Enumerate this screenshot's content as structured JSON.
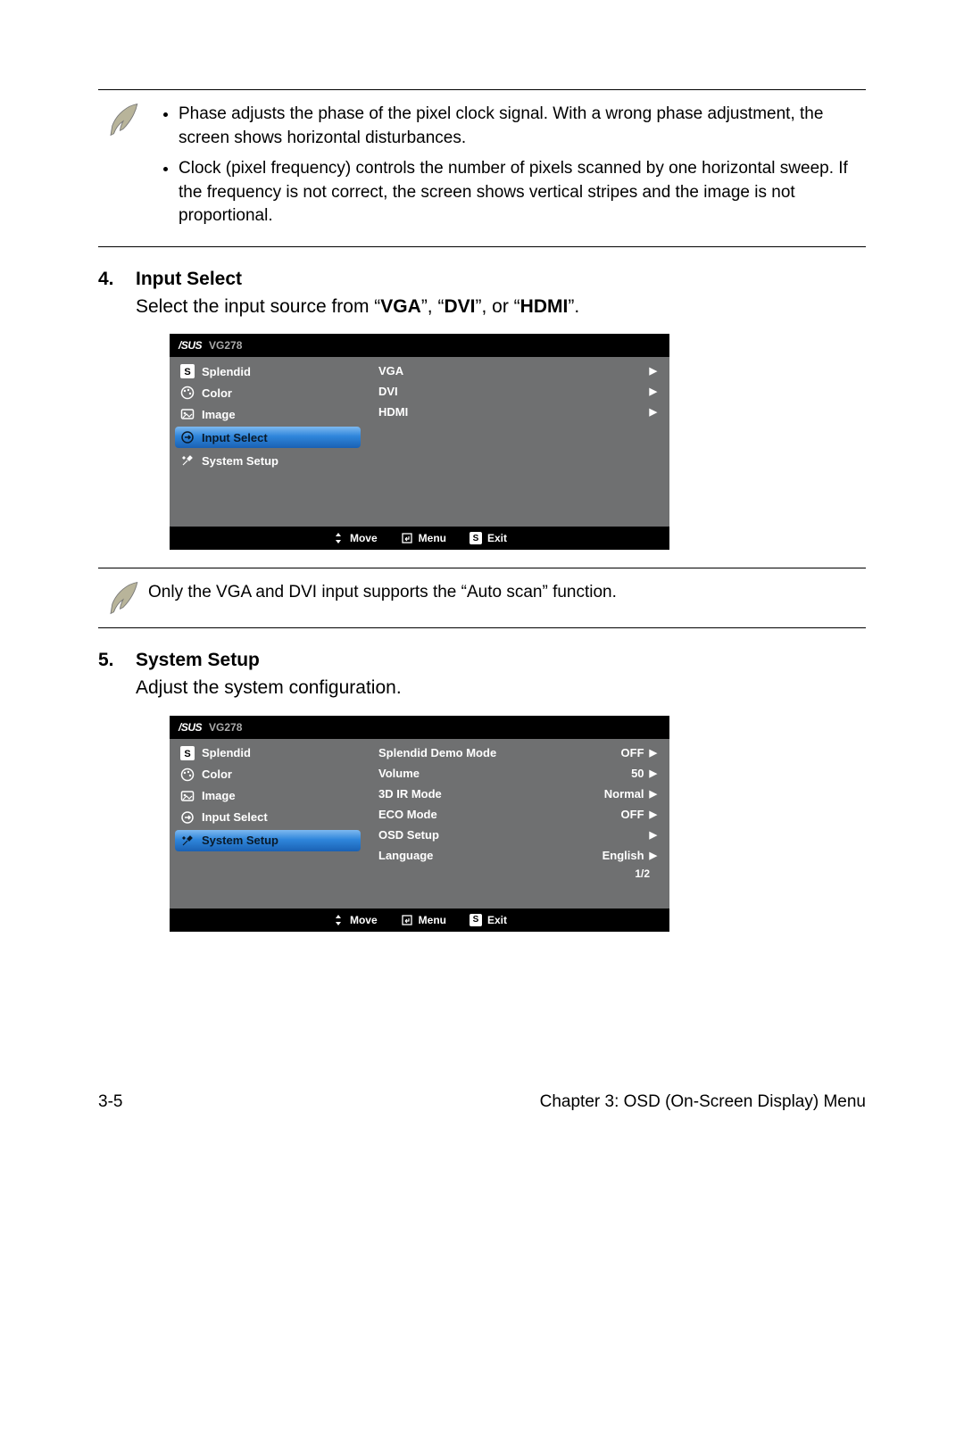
{
  "note1": {
    "bullets": [
      "Phase adjusts the phase of the pixel clock signal. With a wrong phase adjustment, the screen shows horizontal disturbances.",
      "Clock (pixel frequency) controls the number of pixels scanned by one horizontal sweep. If the frequency is not correct, the screen shows vertical stripes and the image is not proportional."
    ]
  },
  "sec4": {
    "num": "4.",
    "title": "Input Select",
    "body_pre": "Select the input source from “",
    "b1": "VGA",
    "mid1": "”, “",
    "b2": "DVI",
    "mid2": "”, or “",
    "b3": "HDMI",
    "end": "”."
  },
  "osd_common": {
    "brand": "/SUS",
    "model": "VG278",
    "left_items": [
      "Splendid",
      "Color",
      "Image",
      "Input Select",
      "System Setup"
    ],
    "footer": {
      "move": "Move",
      "menu": "Menu",
      "exit": "Exit"
    }
  },
  "osd1": {
    "selected_index": 3,
    "right": [
      {
        "label": "VGA",
        "value": ""
      },
      {
        "label": "DVI",
        "value": ""
      },
      {
        "label": "HDMI",
        "value": ""
      }
    ]
  },
  "note2": {
    "text": "Only the VGA and DVI input supports the “Auto scan” function."
  },
  "sec5": {
    "num": "5.",
    "title": "System Setup",
    "body": "Adjust the system configuration."
  },
  "osd2": {
    "selected_index": 4,
    "right": [
      {
        "label": "Splendid Demo Mode",
        "value": "OFF"
      },
      {
        "label": "Volume",
        "value": "50"
      },
      {
        "label": "3D IR Mode",
        "value": "Normal"
      },
      {
        "label": "ECO Mode",
        "value": "OFF"
      },
      {
        "label": "OSD Setup",
        "value": ""
      },
      {
        "label": "Language",
        "value": "English"
      }
    ],
    "pager": "1/2"
  },
  "footer": {
    "left": "3-5",
    "right": "Chapter 3: OSD (On-Screen Display) Menu"
  }
}
